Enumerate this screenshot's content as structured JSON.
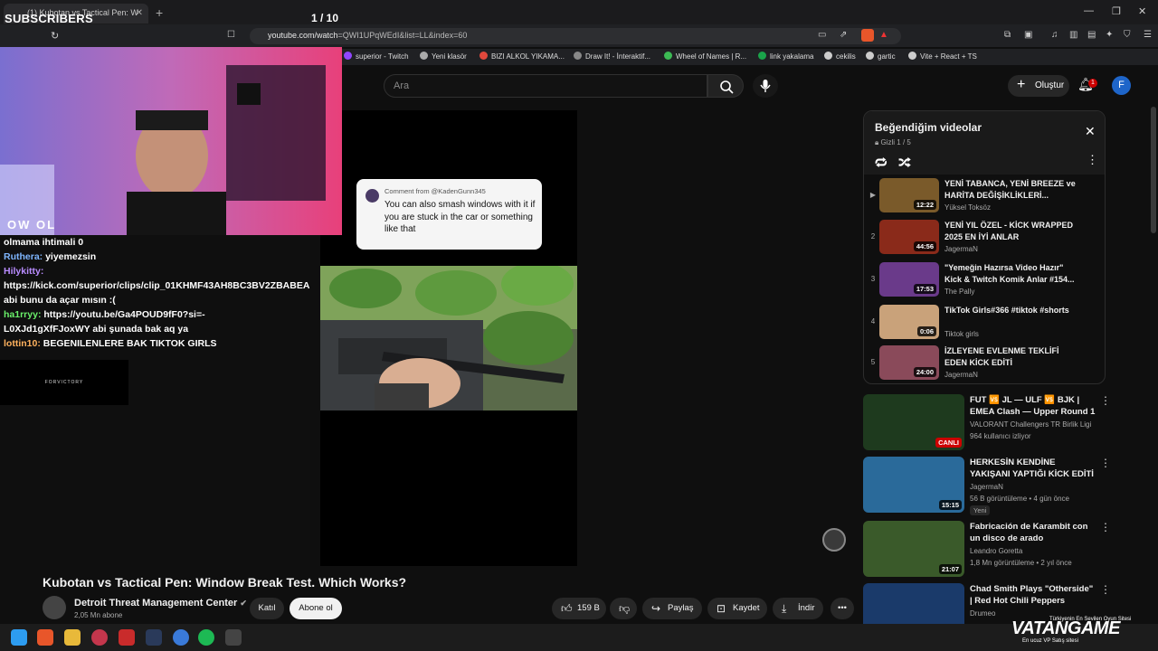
{
  "browser": {
    "tab_title": "(1) Kubotan vs Tactical Pen: W",
    "url_host": "youtube.com/watch",
    "url_rest": "=QWI1UPqWEdI&list=LL&index=60"
  },
  "bookmarks": [
    {
      "label": "superior - Twitch",
      "color": "#9146ff"
    },
    {
      "label": "Yeni klasör",
      "color": "#aaaaaa"
    },
    {
      "label": "BIZI ALKOL YIKAMA...",
      "color": "#e0483c"
    },
    {
      "label": "Draw It! - İnteraktif...",
      "color": "#888888"
    },
    {
      "label": "Wheel of Names | R...",
      "color": "#3cba54"
    },
    {
      "label": "link yakalama",
      "color": "#1aa34a"
    },
    {
      "label": "cekilis",
      "color": "#cccccc"
    },
    {
      "label": "gartic",
      "color": "#cccccc"
    },
    {
      "label": "Vite + React + TS",
      "color": "#cccccc"
    }
  ],
  "youtube": {
    "search_placeholder": "Ara",
    "create_label": "Oluştur",
    "notif_count": "1",
    "avatar_letter": "F"
  },
  "stream_overlay": {
    "title": "SUBSCRIBERS",
    "counter": "1 / 10",
    "logo": "OW OL",
    "sponsor": "FORVICTORY"
  },
  "chat": [
    {
      "user": "",
      "text": "olmama ihtimali 0",
      "cls": ""
    },
    {
      "user": "Ruthera:",
      "text": " yiyemezsin",
      "cls": "u1"
    },
    {
      "user": "Hilykitty:",
      "text": "",
      "cls": "u2"
    },
    {
      "user": "",
      "text": "https://kick.com/superior/clips/clip_01KHMF43AH8BC3BV2ZBABEA",
      "cls": ""
    },
    {
      "user": "",
      "text": "abi bunu da açar mısın :(",
      "cls": ""
    },
    {
      "user": "ha1rryy:",
      "text": " https://youtu.be/Ga4POUD9fF0?si=-",
      "cls": "u3"
    },
    {
      "user": "",
      "text": "L0XJd1gXfFJoxWY abi şunada bak aq ya",
      "cls": ""
    },
    {
      "user": "lottin10:",
      "text": " BEGENILENLERE BAK TIKTOK GIRLS",
      "cls": "u4"
    }
  ],
  "short_comment": {
    "from": "Comment from @KadenGunn345",
    "text": "You can also smash windows with it if you are stuck in the car or something like that"
  },
  "video": {
    "title": "Kubotan vs Tactical Pen: Window Break Test. Which Works?",
    "channel": "Detroit Threat Management Center",
    "subs": "2,05 Mn abone",
    "join": "Katıl",
    "subscribe": "Abone ol",
    "likes": "159 B",
    "share": "Paylaş",
    "save": "Kaydet",
    "download": "İndir"
  },
  "playlist": {
    "title": "Beğendiğim videolar",
    "meta": "Gizli",
    "position": "1 / 5",
    "items": [
      {
        "idx": "▶",
        "title": "YENİ TABANCA, YENİ BREEZE ve HARİTA DEĞİŞİKLİKLERİ...",
        "channel": "Yüksel Toksöz",
        "duration": "12:22",
        "color": "#7a5a2a"
      },
      {
        "idx": "2",
        "title": "YENİ YIL ÖZEL - KİCK WRAPPED 2025 EN İYİ ANLAR",
        "channel": "JagermaN",
        "duration": "44:56",
        "color": "#8a2a1a"
      },
      {
        "idx": "3",
        "title": "\"Yemeğin Hazırsa Video Hazır\" Kick & Twitch Komik Anlar #154...",
        "channel": "The Pally",
        "duration": "17:53",
        "color": "#6a3a8a"
      },
      {
        "idx": "4",
        "title": "TikTok Girls#366 #tiktok #shorts",
        "channel": "Tiktok girls",
        "duration": "0:06",
        "color": "#c9a27a"
      },
      {
        "idx": "5",
        "title": "İZLEYENE EVLENME TEKLİFİ EDEN KİCK EDİTİ",
        "channel": "JagermaN",
        "duration": "24:00",
        "color": "#8a4a5a"
      }
    ]
  },
  "recommendations": [
    {
      "title": "FUT 🆚 JL — ULF 🆚 BJK | EMEA Clash — Upper Round 1",
      "channel": "VALORANT Challengers TR Birlik Ligi",
      "meta": "964 kullanıcı izliyor",
      "badge": "",
      "duration": "CANLI",
      "live": true,
      "color": "#1e3a1e"
    },
    {
      "title": "HERKESİN KENDİNE YAKIŞANI YAPTIĞI KİCK EDİTİ",
      "channel": "JagermaN",
      "meta": "56 B görüntüleme • 4 gün önce",
      "badge": "Yeni",
      "duration": "15:15",
      "live": false,
      "color": "#2a6a9a"
    },
    {
      "title": "Fabricación de Karambit con un disco de arado",
      "channel": "Leandro Goretta",
      "meta": "1,8 Mn görüntüleme • 2 yıl önce",
      "badge": "",
      "duration": "21:07",
      "live": false,
      "color": "#3a5a2a"
    },
    {
      "title": "Chad Smith Plays \"Otherside\" | Red Hot Chili Peppers",
      "channel": "Drumeo",
      "meta": "",
      "badge": "",
      "duration": "",
      "live": false,
      "color": "#1a3a6a"
    }
  ],
  "watermark": {
    "brand": "VATANGAME",
    "tag1": "Türkiyenin En Sevilen Oyun Sitesi",
    "tag2": "En ucuz VP Satış sitesi"
  }
}
